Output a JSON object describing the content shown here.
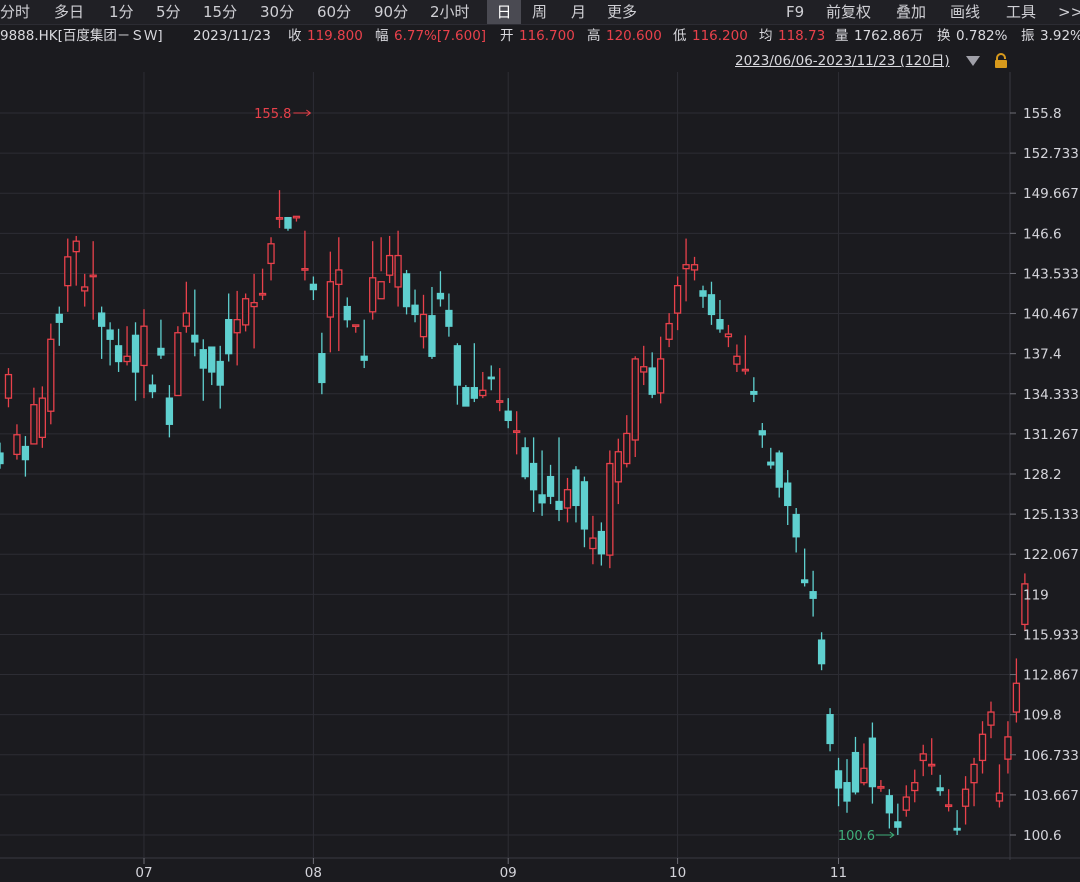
{
  "toolbar": {
    "periods": [
      "分时",
      "多日",
      "1分",
      "5分",
      "15分",
      "30分",
      "60分",
      "90分",
      "2小时",
      "日",
      "周",
      "月",
      "更多"
    ],
    "active_period": "日",
    "right": [
      "F9",
      "前复权",
      "叠加",
      "画线",
      "工具",
      ">>"
    ]
  },
  "quote": {
    "code_name": "9888.HK[百度集团－ＳＷ]",
    "date": "2023/11/23",
    "close_label": "收",
    "close": "119.800",
    "change_label": "幅",
    "change": "6.77%[7.600]",
    "open_label": "开",
    "open": "116.700",
    "high_label": "高",
    "high": "120.600",
    "low_label": "低",
    "low": "116.200",
    "avg_label": "均",
    "avg": "118.73",
    "volume_label": "量",
    "volume": "1762.86万",
    "turnover_label": "换",
    "turnover": "0.782%",
    "amplitude_label": "振",
    "amplitude": "3.92%"
  },
  "range_label": "2023/06/06-2023/11/23 (120日)",
  "colors": {
    "up": "#e8414b",
    "down": "#5fd0cf",
    "bg": "#1b1b1f",
    "grid": "#2d2d34"
  },
  "chart_data": {
    "type": "candlestick",
    "ylim": [
      100.6,
      155.8
    ],
    "y_ticks": [
      "155.8",
      "152.733",
      "149.667",
      "146.6",
      "143.533",
      "140.467",
      "137.4",
      "134.333",
      "131.267",
      "128.2",
      "125.133",
      "122.067",
      "119",
      "115.933",
      "112.867",
      "109.8",
      "106.733",
      "103.667",
      "100.6"
    ],
    "x_ticks": [
      {
        "label": "07",
        "index": 17
      },
      {
        "label": "08",
        "index": 37
      },
      {
        "label": "09",
        "index": 60
      },
      {
        "label": "10",
        "index": 80
      },
      {
        "label": "11",
        "index": 99
      }
    ],
    "annotations": [
      {
        "text": "155.8",
        "kind": "high",
        "index": 37,
        "value": 155.8
      },
      {
        "text": "100.6",
        "kind": "low",
        "index": 106,
        "value": 100.6
      }
    ],
    "ohlc": [
      [
        129.8,
        129.0,
        130.6,
        128.6
      ],
      [
        134.0,
        135.8,
        136.3,
        133.3
      ],
      [
        129.7,
        131.2,
        132.0,
        129.3
      ],
      [
        130.3,
        129.3,
        131.1,
        128.0
      ],
      [
        130.5,
        133.5,
        134.8,
        130.5
      ],
      [
        131.0,
        134.0,
        134.9,
        130.2
      ],
      [
        133.0,
        138.5,
        139.7,
        132.0
      ],
      [
        140.4,
        139.8,
        141.0,
        138.0
      ],
      [
        142.6,
        144.8,
        146.2,
        140.6
      ],
      [
        145.2,
        146.0,
        146.4,
        142.6
      ],
      [
        142.2,
        142.5,
        143.5,
        141.0
      ],
      [
        143.4,
        143.4,
        146.0,
        140.0
      ],
      [
        140.5,
        139.5,
        141.0,
        137.0
      ],
      [
        139.2,
        138.5,
        139.8,
        136.5
      ],
      [
        138.0,
        136.8,
        139.3,
        136.0
      ],
      [
        136.8,
        137.2,
        139.5,
        136.5
      ],
      [
        138.8,
        136.0,
        139.8,
        133.8
      ],
      [
        136.5,
        139.5,
        140.8,
        134.0
      ],
      [
        135.0,
        134.5,
        135.8,
        134.0
      ],
      [
        137.8,
        137.3,
        140.0,
        137.0
      ],
      [
        134.0,
        132.0,
        135.0,
        131.0
      ],
      [
        134.2,
        139.0,
        139.5,
        134.2
      ],
      [
        139.5,
        140.5,
        142.9,
        139.0
      ],
      [
        138.8,
        138.3,
        142.3,
        137.2
      ],
      [
        137.7,
        136.3,
        138.5,
        133.8
      ],
      [
        137.9,
        136.0,
        137.9,
        135.0
      ],
      [
        136.8,
        135.0,
        138.0,
        133.2
      ],
      [
        140.0,
        137.4,
        142.0,
        136.8
      ],
      [
        139.0,
        140.0,
        142.2,
        136.5
      ],
      [
        139.6,
        141.6,
        142.0,
        139.1
      ],
      [
        141.0,
        141.3,
        143.5,
        137.8
      ],
      [
        142.0,
        142.0,
        143.9,
        141.5
      ],
      [
        144.3,
        145.8,
        146.3,
        143.0
      ],
      [
        147.7,
        147.8,
        149.9,
        147.0
      ],
      [
        147.8,
        147.0,
        147.8,
        146.8
      ],
      [
        147.9,
        147.9,
        147.9,
        147.5
      ],
      [
        143.9,
        143.9,
        146.8,
        143.0
      ],
      [
        142.7,
        142.3,
        143.3,
        141.5
      ],
      [
        137.4,
        135.2,
        139.0,
        134.3
      ],
      [
        140.2,
        142.9,
        145.2,
        137.5
      ],
      [
        142.7,
        143.8,
        146.3,
        137.6
      ],
      [
        141.0,
        140.0,
        141.7,
        139.4
      ],
      [
        139.6,
        139.6,
        139.6,
        139.0
      ],
      [
        137.2,
        136.9,
        140.0,
        136.3
      ],
      [
        140.6,
        143.2,
        146.0,
        140.0
      ],
      [
        141.6,
        142.9,
        146.3,
        143.7
      ],
      [
        143.4,
        144.9,
        146.4,
        142.8
      ],
      [
        142.5,
        144.9,
        146.8,
        141.0
      ],
      [
        143.5,
        141.0,
        143.8,
        140.4
      ],
      [
        141.1,
        140.4,
        142.3,
        139.8
      ],
      [
        138.7,
        140.4,
        141.9,
        137.8
      ],
      [
        140.3,
        137.2,
        142.5,
        137.0
      ],
      [
        142.0,
        141.6,
        143.7,
        141.0
      ],
      [
        140.7,
        139.5,
        142.0,
        138.7
      ],
      [
        138.0,
        135.0,
        138.2,
        133.5
      ],
      [
        134.8,
        133.4,
        135.0,
        133.4
      ],
      [
        134.8,
        134.0,
        138.2,
        133.7
      ],
      [
        134.2,
        134.6,
        136.0,
        134.0
      ],
      [
        135.6,
        135.5,
        136.5,
        134.6
      ],
      [
        133.7,
        133.8,
        136.3,
        133.0
      ],
      [
        133.0,
        132.3,
        134.0,
        131.7
      ],
      [
        131.5,
        131.5,
        133.0,
        129.7
      ],
      [
        130.2,
        128.0,
        131.0,
        127.8
      ],
      [
        129.0,
        127.0,
        131.0,
        125.3
      ],
      [
        126.6,
        126.0,
        130.0,
        125.0
      ],
      [
        128.0,
        126.5,
        128.9,
        125.9
      ],
      [
        126.1,
        125.5,
        131.0,
        124.6
      ],
      [
        125.6,
        127.0,
        127.9,
        124.5
      ],
      [
        128.5,
        125.8,
        128.8,
        124.5
      ],
      [
        127.6,
        124.0,
        128.0,
        122.6
      ],
      [
        122.5,
        123.3,
        125.0,
        121.3
      ],
      [
        123.8,
        122.1,
        124.5,
        121.2
      ],
      [
        122.0,
        129.0,
        130.0,
        121.0
      ],
      [
        127.6,
        129.9,
        130.9,
        125.9
      ],
      [
        129.0,
        131.3,
        132.7,
        128.7
      ],
      [
        130.8,
        137.0,
        137.2,
        129.5
      ],
      [
        136.0,
        136.4,
        138.0,
        135.0
      ],
      [
        136.3,
        134.3,
        137.5,
        134.0
      ],
      [
        134.4,
        137.0,
        138.7,
        133.6
      ],
      [
        138.5,
        139.7,
        140.5,
        137.9
      ],
      [
        140.5,
        142.6,
        143.3,
        139.2
      ],
      [
        143.9,
        144.2,
        146.2,
        141.4
      ],
      [
        143.8,
        144.2,
        144.8,
        143.0
      ],
      [
        142.2,
        141.8,
        142.6,
        140.9
      ],
      [
        141.9,
        140.4,
        142.9,
        139.6
      ],
      [
        140.0,
        139.3,
        141.5,
        139.0
      ],
      [
        138.7,
        138.9,
        139.6,
        137.9
      ],
      [
        136.6,
        137.2,
        138.1,
        136.0
      ],
      [
        136.1,
        136.2,
        138.8,
        135.8
      ],
      [
        134.5,
        134.3,
        135.6,
        133.7
      ],
      [
        131.5,
        131.2,
        132.1,
        130.2
      ],
      [
        129.1,
        128.9,
        130.2,
        128.6
      ],
      [
        129.8,
        127.2,
        130.0,
        126.4
      ],
      [
        127.5,
        125.8,
        128.5,
        124.3
      ],
      [
        125.1,
        123.4,
        125.6,
        122.2
      ],
      [
        120.1,
        119.9,
        122.5,
        119.6
      ],
      [
        119.2,
        118.7,
        120.8,
        117.3
      ],
      [
        115.5,
        113.7,
        116.1,
        113.2
      ],
      [
        109.8,
        107.6,
        110.3,
        107.0
      ],
      [
        105.5,
        104.2,
        106.5,
        102.8
      ],
      [
        104.6,
        103.2,
        106.4,
        102.3
      ],
      [
        106.9,
        103.9,
        108.1,
        103.7
      ],
      [
        104.6,
        105.7,
        107.6,
        104.4
      ],
      [
        108.0,
        104.3,
        109.2,
        103.0
      ],
      [
        104.3,
        104.3,
        104.8,
        103.9
      ],
      [
        103.6,
        102.3,
        104.1,
        101.1
      ],
      [
        101.6,
        101.2,
        103.0,
        100.6
      ],
      [
        102.5,
        103.5,
        104.4,
        102.0
      ],
      [
        104.0,
        104.6,
        105.6,
        103.1
      ],
      [
        106.3,
        106.8,
        107.5,
        105.1
      ],
      [
        106.0,
        106.0,
        108.0,
        105.2
      ],
      [
        104.2,
        104.0,
        105.2,
        103.6
      ],
      [
        102.9,
        102.9,
        104.1,
        102.4
      ],
      [
        101.1,
        101.0,
        102.5,
        100.6
      ],
      [
        102.8,
        104.1,
        105.1,
        101.4
      ],
      [
        104.6,
        106.0,
        106.5,
        102.8
      ],
      [
        106.3,
        108.3,
        109.3,
        105.3
      ],
      [
        109.0,
        110.0,
        110.8,
        108.0
      ],
      [
        103.2,
        103.8,
        106.0,
        102.7
      ],
      [
        106.4,
        108.1,
        109.3,
        105.3
      ],
      [
        110.0,
        112.2,
        114.1,
        109.2
      ],
      [
        116.7,
        119.8,
        120.6,
        116.2
      ]
    ]
  }
}
